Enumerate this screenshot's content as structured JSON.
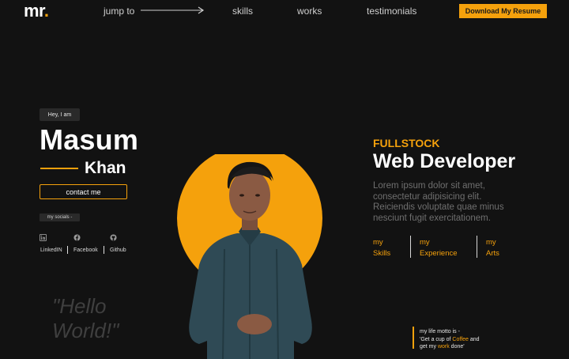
{
  "nav": {
    "logo_text": "mr",
    "logo_dot": ".",
    "jump_label": "jump to",
    "links": [
      "skills",
      "works",
      "testimonials"
    ],
    "resume_button": "Download My Resume"
  },
  "hero_left": {
    "greeting": "Hey, I am",
    "first_name": "Masum",
    "last_name": "Khan",
    "contact_button": "contact me",
    "socials_label": "my socials -",
    "socials": [
      {
        "label": "LinkedIN",
        "icon": "linkedin-icon"
      },
      {
        "label": "Facebook",
        "icon": "facebook-icon"
      },
      {
        "label": "Github",
        "icon": "github-icon"
      }
    ],
    "hello_line1": "\"Hello",
    "hello_line2": "World!\""
  },
  "hero_right": {
    "eyebrow": "FULLSTOCK",
    "role": "Web Developer",
    "description": "Lorem ipsum dolor sit amet, consectetur adipisicing elit. Reiciendis voluptate quae minus nesciunt fugit exercitationem.",
    "links": [
      {
        "line1": "my",
        "line2": "Skills"
      },
      {
        "line1": "my",
        "line2": "Experience"
      },
      {
        "line1": "my",
        "line2": "Arts"
      }
    ],
    "motto": {
      "heading": "my life motto is -",
      "part1": "'Get a cup of ",
      "highlight1": "Coffee",
      "part2": " and",
      "part3": "get my ",
      "highlight2": "work",
      "part4": " done'"
    }
  },
  "colors": {
    "accent": "#f5a10c",
    "background": "#121212",
    "muted_text": "#6f6f6f"
  }
}
